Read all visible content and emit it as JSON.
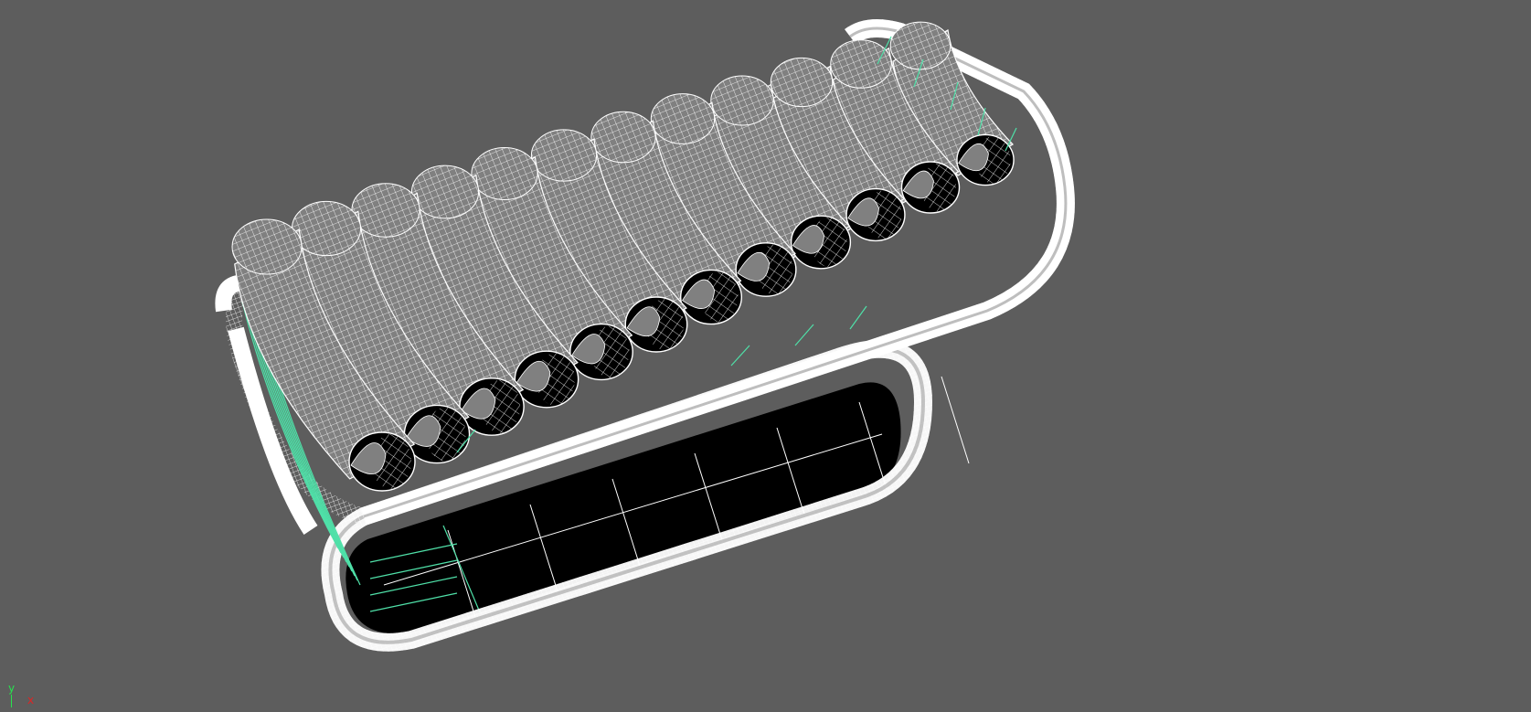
{
  "viewport": {
    "background_color": "#5d5d5d",
    "wire_color": "#ffffff",
    "selected_wire_color": "#4fe0a8",
    "fill_color": "#808080",
    "cavity_color": "#000000",
    "roller_count": 12
  },
  "axis_gizmo": {
    "y_label": "y",
    "x_label": "x",
    "y_color": "#27e34f",
    "x_color": "#e02424"
  }
}
